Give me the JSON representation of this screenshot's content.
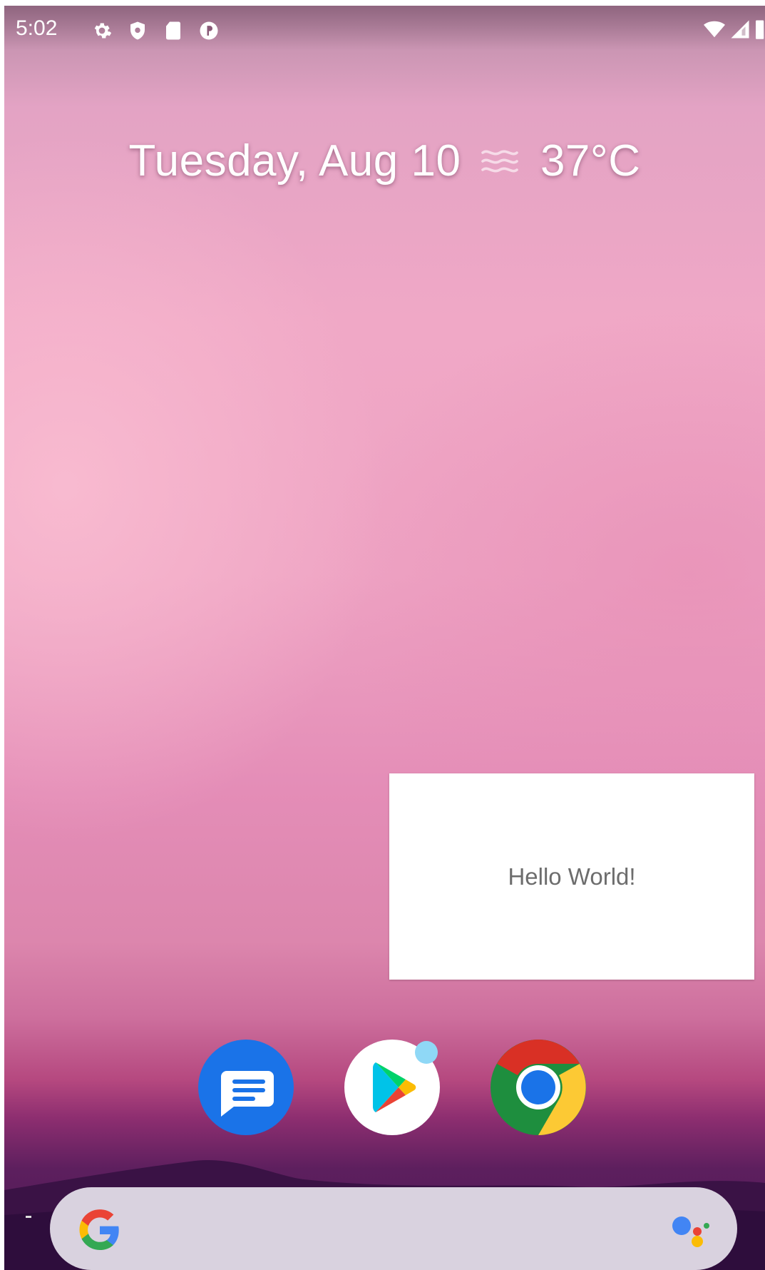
{
  "status_bar": {
    "time": "5:02",
    "notification_icons": [
      "settings-icon",
      "shield-icon",
      "sd-card-icon",
      "app-notification-icon"
    ],
    "system_icons": [
      "wifi-icon",
      "signal-icon",
      "battery-icon"
    ]
  },
  "at_a_glance": {
    "date": "Tuesday, Aug 10",
    "weather_icon": "haze-icon",
    "temperature": "37°C"
  },
  "popup": {
    "text": "Hello World!"
  },
  "dock": {
    "apps": [
      "messages-icon",
      "play-store-icon",
      "chrome-icon"
    ],
    "play_store_badge_color": "#8fd8f6"
  },
  "search_bar": {
    "logo": "google-g-icon",
    "assistant": "google-assistant-icon"
  },
  "colors": {
    "wallpaper_top": "#e3a3c4",
    "wallpaper_bottom": "#4a1a54",
    "search_bar": "#d9d2df",
    "popup_bg": "#ffffff"
  }
}
